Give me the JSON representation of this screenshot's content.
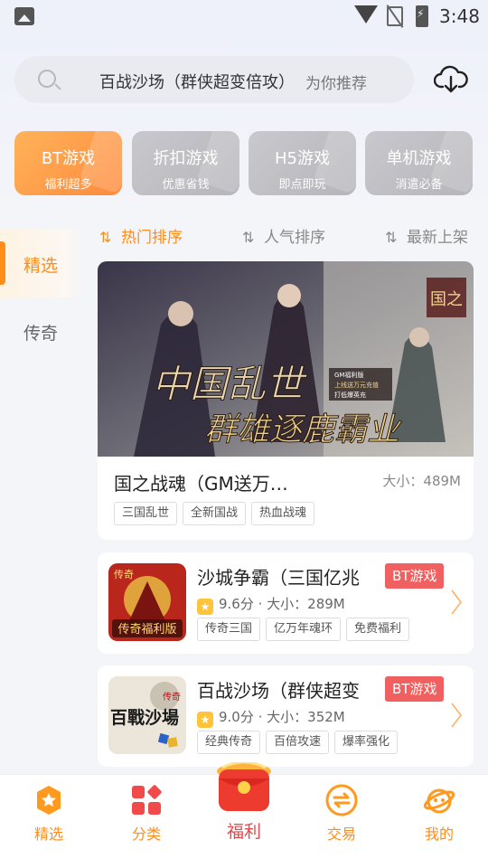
{
  "status_bar": {
    "time": "3:48"
  },
  "search": {
    "query": "百战沙场（群侠超变倍攻）",
    "hint": "为你推荐"
  },
  "categories": [
    {
      "title": "BT游戏",
      "subtitle": "福利超多"
    },
    {
      "title": "折扣游戏",
      "subtitle": "优惠省钱"
    },
    {
      "title": "H5游戏",
      "subtitle": "即点即玩"
    },
    {
      "title": "单机游戏",
      "subtitle": "消遣必备"
    }
  ],
  "left_nav": [
    {
      "label": "精选"
    },
    {
      "label": "传奇"
    }
  ],
  "sort_tabs": [
    {
      "label": "热门排序"
    },
    {
      "label": "人气排序"
    },
    {
      "label": "最新上架"
    }
  ],
  "featured": {
    "banner_text_1": "中国乱世",
    "banner_text_2": "群雄逐鹿霸业",
    "banner_logo": "国之",
    "banner_note_1": "GM福利版",
    "banner_note_2": "上线送万元充值",
    "banner_note_3": "打低爆英充",
    "name": "国之战魂（GM送万…",
    "size": "大小：489M",
    "tags": [
      "三国乱世",
      "全新国战",
      "热血战魂"
    ]
  },
  "games": [
    {
      "name": "沙城争霸（三国亿兆",
      "badge": "BT游戏",
      "rating": "9.6分",
      "size": "大小：289M",
      "icon_text": "传奇福利版",
      "icon_top": "传奇",
      "tags": [
        "传奇三国",
        "亿万年魂环",
        "免费福利"
      ]
    },
    {
      "name": "百战沙场（群侠超变",
      "badge": "BT游戏",
      "rating": "9.0分",
      "size": "大小：352M",
      "icon_text": "百戰沙場",
      "icon_top": "传奇",
      "tags": [
        "经典传奇",
        "百倍攻速",
        "爆率强化"
      ]
    }
  ],
  "bottom_nav": [
    {
      "label": "精选"
    },
    {
      "label": "分类"
    },
    {
      "label": "福利"
    },
    {
      "label": "交易"
    },
    {
      "label": "我的"
    }
  ],
  "colors": {
    "accent": "#ff8d1a",
    "badge": "#f06060",
    "fuli": "#e8464a"
  }
}
